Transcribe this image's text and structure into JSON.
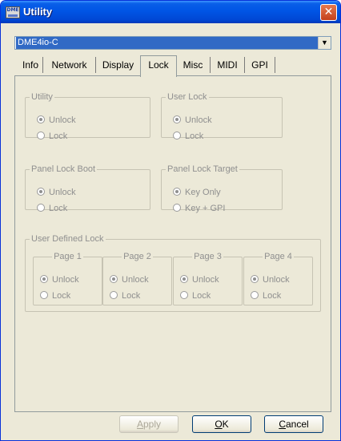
{
  "window": {
    "title": "Utility"
  },
  "device_select": {
    "value": "DME4io-C"
  },
  "tabs": [
    {
      "label": "Info"
    },
    {
      "label": "Network"
    },
    {
      "label": "Display"
    },
    {
      "label": "Lock",
      "selected": true
    },
    {
      "label": "Misc"
    },
    {
      "label": "MIDI"
    },
    {
      "label": "GPI"
    }
  ],
  "groups": {
    "utility": {
      "title": "Utility",
      "options": [
        "Unlock",
        "Lock"
      ],
      "selected": "Unlock"
    },
    "user_lock": {
      "title": "User Lock",
      "options": [
        "Unlock",
        "Lock"
      ],
      "selected": "Unlock"
    },
    "panel_lock_boot": {
      "title": "Panel Lock Boot",
      "options": [
        "Unlock",
        "Lock"
      ],
      "selected": "Unlock"
    },
    "panel_lock_target": {
      "title": "Panel Lock Target",
      "options": [
        "Key Only",
        "Key + GPI"
      ],
      "selected": "Key Only"
    },
    "user_defined_lock": {
      "title": "User Defined Lock",
      "pages": [
        {
          "title": "Page 1",
          "options": [
            "Unlock",
            "Lock"
          ],
          "selected": "Unlock"
        },
        {
          "title": "Page 2",
          "options": [
            "Unlock",
            "Lock"
          ],
          "selected": "Unlock"
        },
        {
          "title": "Page 3",
          "options": [
            "Unlock",
            "Lock"
          ],
          "selected": "Unlock"
        },
        {
          "title": "Page 4",
          "options": [
            "Unlock",
            "Lock"
          ],
          "selected": "Unlock"
        }
      ]
    }
  },
  "buttons": {
    "apply": {
      "label_pre": "",
      "mnemonic": "A",
      "label_post": "pply",
      "enabled": false
    },
    "ok": {
      "label_pre": "",
      "mnemonic": "O",
      "label_post": "K"
    },
    "cancel": {
      "label_pre": "",
      "mnemonic": "C",
      "label_post": "ancel"
    }
  },
  "icons": {
    "app": "dme-app-icon",
    "close": "close-icon",
    "dropdown": "chevron-down-icon"
  },
  "colors": {
    "title_bar": "#0055e5",
    "close_button": "#d9542d",
    "selection": "#316ac5",
    "dialog_bg": "#ece9d8"
  }
}
